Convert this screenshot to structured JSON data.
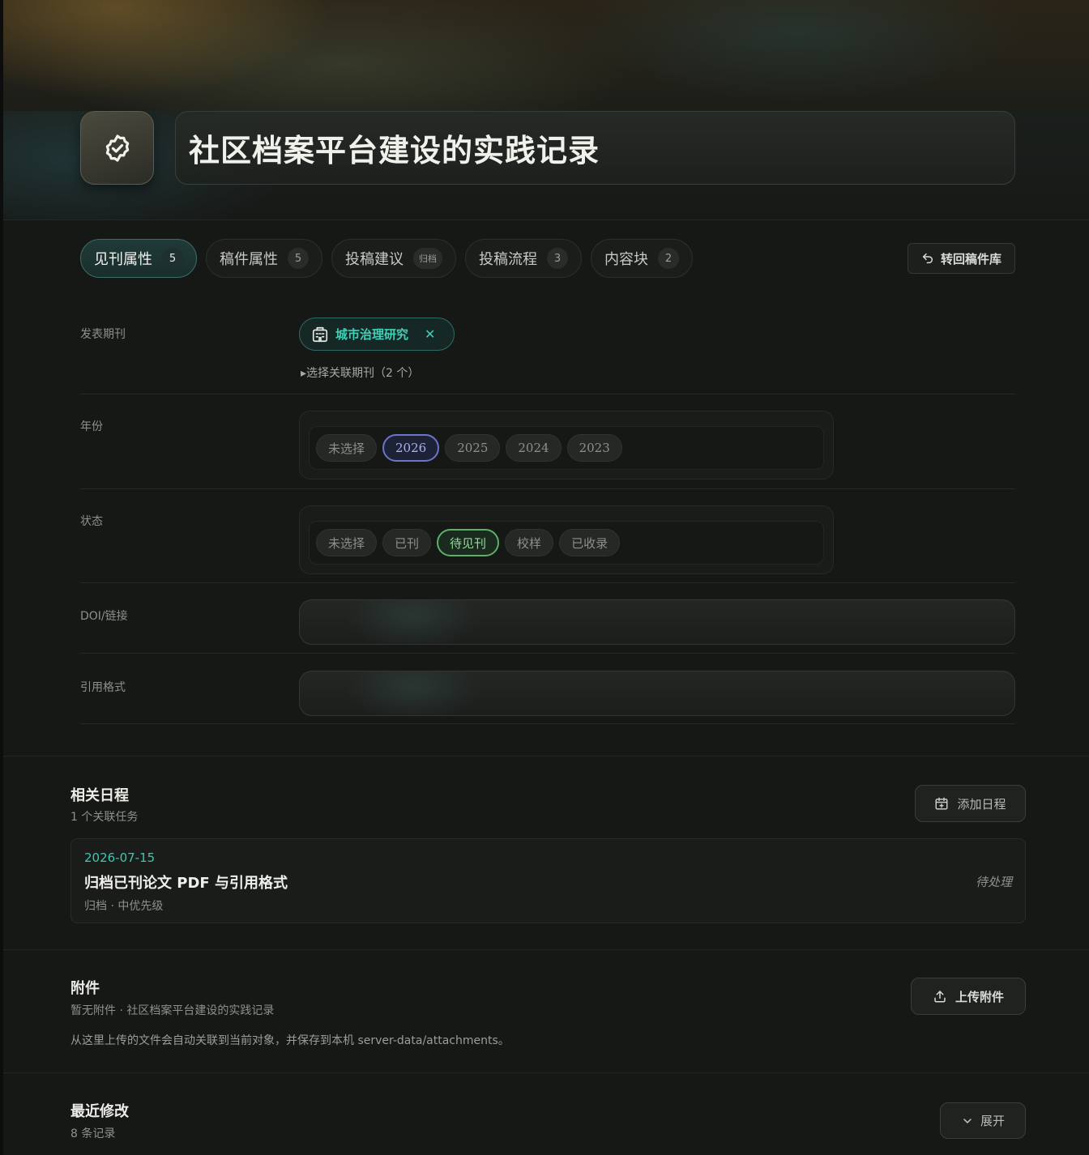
{
  "header": {
    "title": "社区档案平台建设的实践记录",
    "avatar_icon": "check-badge-icon"
  },
  "tabs": [
    {
      "label": "见刊属性",
      "badge": "5",
      "active": true
    },
    {
      "label": "稿件属性",
      "badge": "5"
    },
    {
      "label": "投稿建议",
      "badge": "归档"
    },
    {
      "label": "投稿流程",
      "badge": "3"
    },
    {
      "label": "内容块",
      "badge": "2"
    }
  ],
  "back_button": {
    "label": "转回稿件库",
    "icon": "undo-arrow-icon"
  },
  "form": {
    "journal": {
      "label": "发表期刊",
      "chip_icon": "building-icon",
      "chip_label": "城市治理研究",
      "select_text": "▸选择关联期刊（2 个）"
    },
    "year": {
      "label": "年份",
      "options": [
        "未选择",
        "2026",
        "2025",
        "2024",
        "2023"
      ],
      "selected": "2026"
    },
    "status": {
      "label": "状态",
      "options": [
        "未选择",
        "已刊",
        "待见刊",
        "校样",
        "已收录"
      ],
      "selected": "待见刊"
    },
    "doi": {
      "label": "DOI/链接",
      "value": ""
    },
    "citation": {
      "label": "引用格式",
      "value": ""
    }
  },
  "schedule": {
    "title": "相关日程",
    "subtitle": "1 个关联任务",
    "add_button": "添加日程",
    "tasks": [
      {
        "date": "2026-07-15",
        "title": "归档已刊论文 PDF 与引用格式",
        "meta": "归档 · 中优先级",
        "status": "待处理"
      }
    ]
  },
  "attachments": {
    "title": "附件",
    "subtitle": "暂无附件 · 社区档案平台建设的实践记录",
    "upload_button": "上传附件",
    "note": "从这里上传的文件会自动关联到当前对象，并保存到本机 server-data/attachments。"
  },
  "recent": {
    "title": "最近修改",
    "subtitle": "8 条记录",
    "expand_button": "展开"
  },
  "colors": {
    "accent_teal": "#3fd1b6",
    "selected_year": "#6b75c9",
    "selected_status": "#5fae6a"
  }
}
